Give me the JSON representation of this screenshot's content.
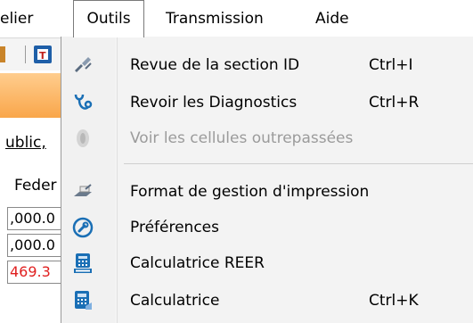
{
  "menubar": {
    "items": [
      {
        "label": "elier"
      },
      {
        "label": "Outils"
      },
      {
        "label": "Transmission"
      },
      {
        "label": "Aide"
      }
    ]
  },
  "background": {
    "public_text": "ublic,",
    "feder_text": "Feder",
    "cell_1": ",000.0",
    "cell_2": ",000.0",
    "cell_3": "469.3",
    "cell_3_color": "#e02020"
  },
  "menu": {
    "items": [
      {
        "label": "Revue de la section ID",
        "shortcut": "Ctrl+I",
        "icon": "review-pencil-icon",
        "enabled": true
      },
      {
        "label": "Revoir les Diagnostics",
        "shortcut": "Ctrl+R",
        "icon": "stethoscope-icon",
        "enabled": true
      },
      {
        "label": "Voir les cellules outrepassées",
        "shortcut": "",
        "icon": "eye-icon",
        "enabled": false
      },
      {
        "label": "Format de gestion d'impression",
        "shortcut": "",
        "icon": "print-format-icon",
        "enabled": true
      },
      {
        "label": "Préférences",
        "shortcut": "",
        "icon": "wrench-icon",
        "enabled": true
      },
      {
        "label": "Calculatrice REER",
        "shortcut": "",
        "icon": "rrsp-calculator-icon",
        "enabled": true
      },
      {
        "label": "Calculatrice",
        "shortcut": "Ctrl+K",
        "icon": "calculator-icon",
        "enabled": true
      }
    ],
    "accent_color": "#1a6fb5",
    "disabled_color": "#9b9b9b"
  }
}
